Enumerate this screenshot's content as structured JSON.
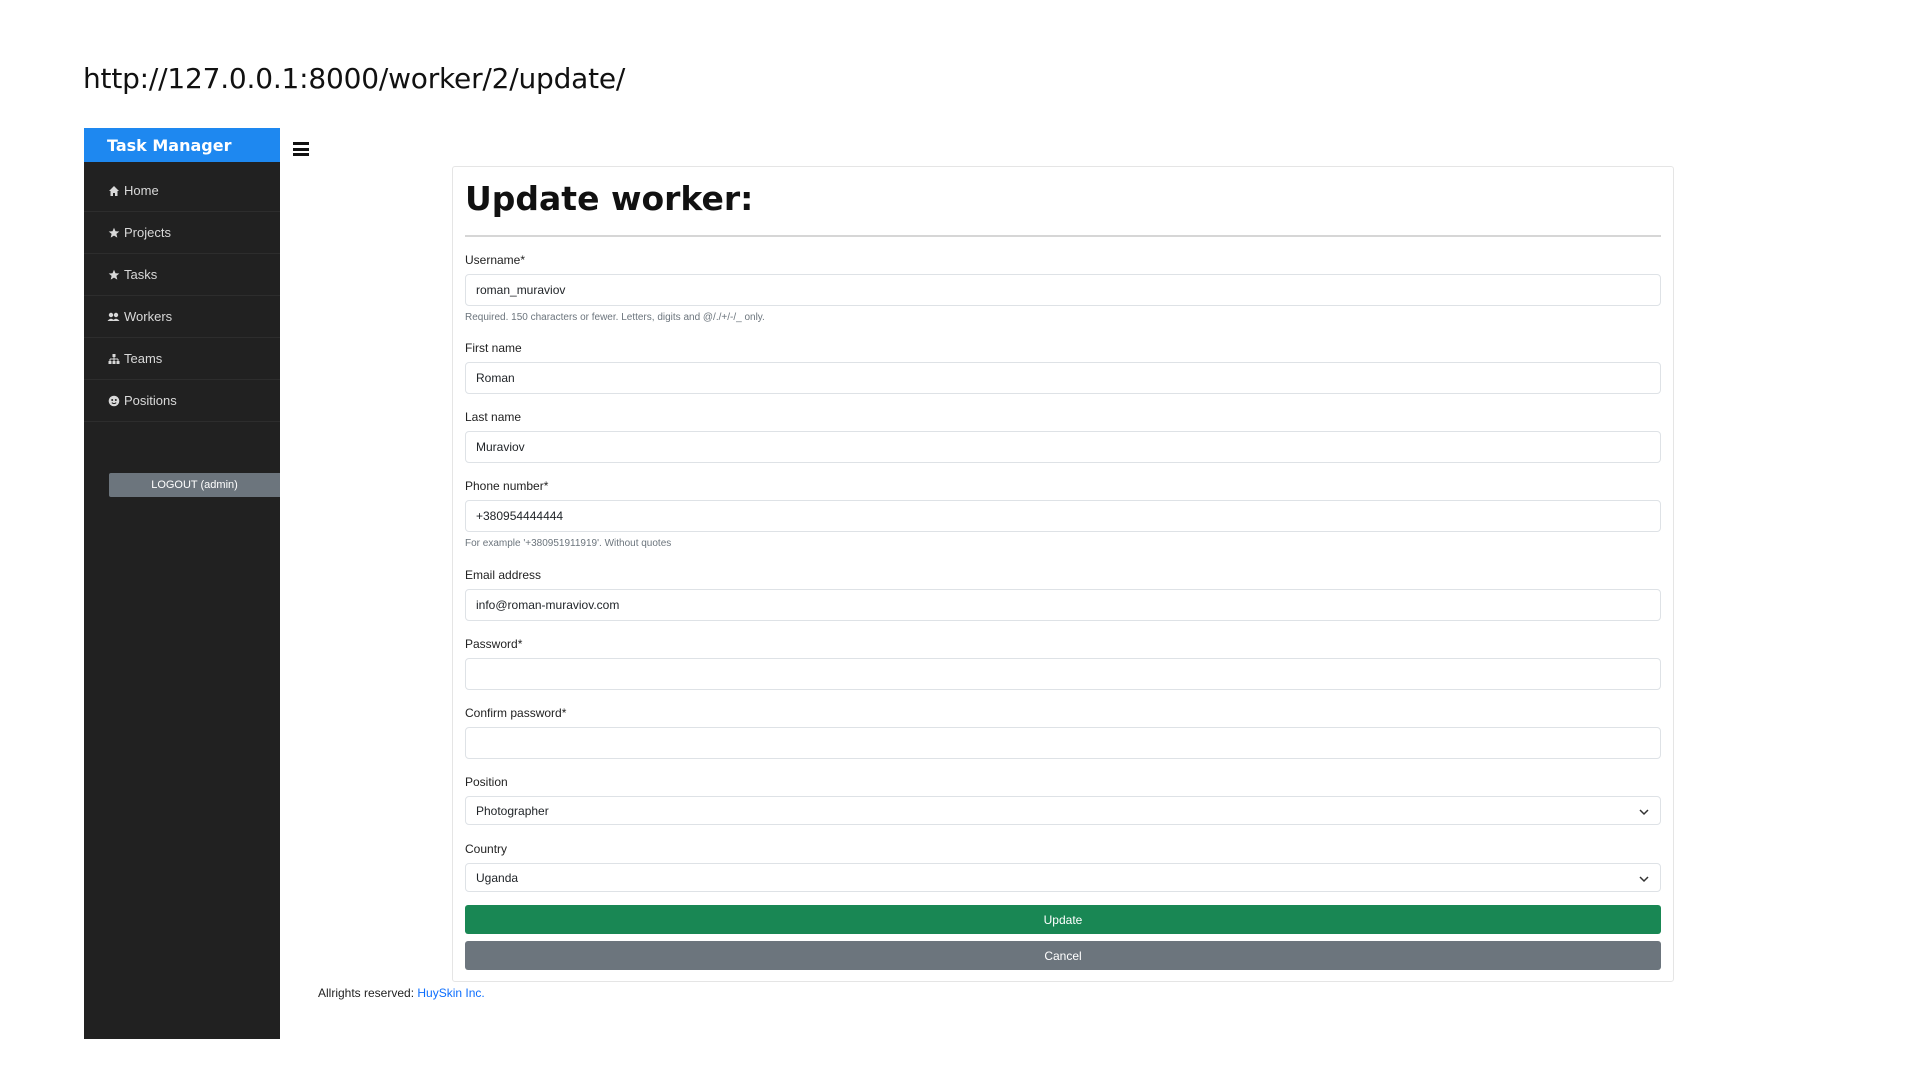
{
  "url_caption": "http://127.0.0.1:8000/worker/2/update/",
  "sidebar": {
    "brand": "Task Manager",
    "items": [
      {
        "label": "Home",
        "icon": "home-icon"
      },
      {
        "label": "Projects",
        "icon": "star-icon"
      },
      {
        "label": "Tasks",
        "icon": "star-icon"
      },
      {
        "label": "Workers",
        "icon": "users-icon"
      },
      {
        "label": "Teams",
        "icon": "sitemap-icon"
      },
      {
        "label": "Positions",
        "icon": "face-icon"
      }
    ],
    "logout_label": "LOGOUT (admin)"
  },
  "form": {
    "title": "Update worker:",
    "username": {
      "label": "Username*",
      "value": "roman_muraviov",
      "help": "Required. 150 characters or fewer. Letters, digits and @/./+/-/_ only."
    },
    "first_name": {
      "label": "First name",
      "value": "Roman"
    },
    "last_name": {
      "label": "Last name",
      "value": "Muraviov"
    },
    "phone": {
      "label": "Phone number*",
      "value": "+380954444444",
      "help": "For example '+380951911919'. Without quotes"
    },
    "email": {
      "label": "Email address",
      "value": "info@roman-muraviov.com"
    },
    "password": {
      "label": "Password*",
      "value": ""
    },
    "confirm_password": {
      "label": "Confirm password*",
      "value": ""
    },
    "position": {
      "label": "Position",
      "value": "Photographer"
    },
    "country": {
      "label": "Country",
      "value": "Uganda"
    },
    "update_label": "Update",
    "cancel_label": "Cancel"
  },
  "footer": {
    "prefix": "Allrights reserved:",
    "link": "HuySkin Inc."
  },
  "colors": {
    "brand": "#1e88f0",
    "sidebar_bg": "#212121",
    "update": "#198754",
    "cancel": "#6c757d",
    "link": "#0d6efd"
  }
}
